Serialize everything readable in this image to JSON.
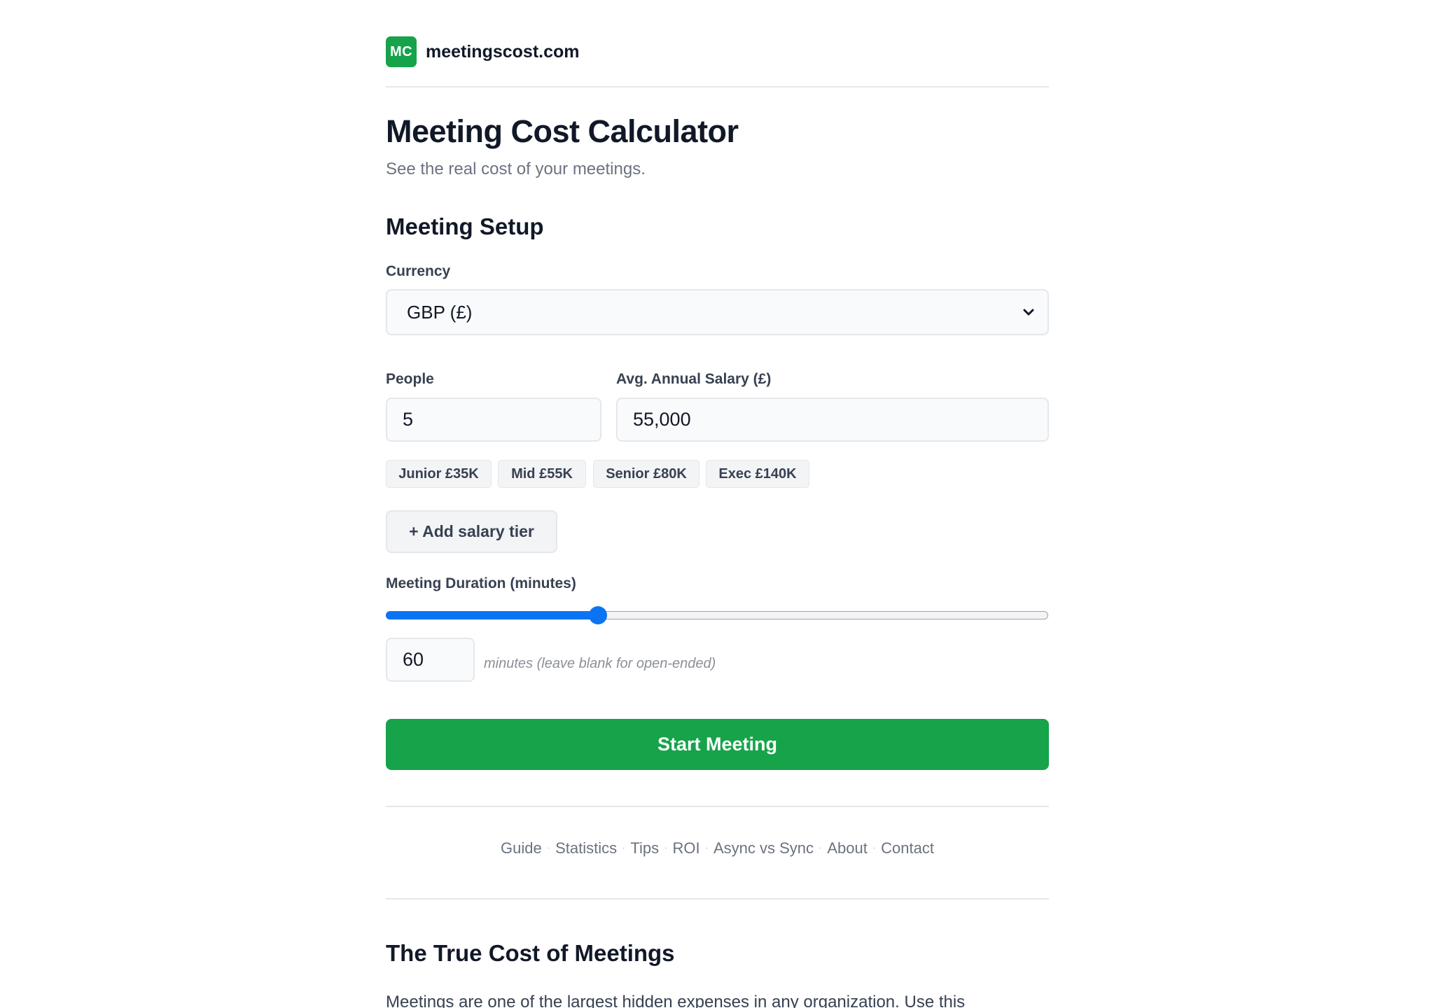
{
  "brand": {
    "logo_text": "MC",
    "name": "meetingscost.com",
    "logo_color": "#16a34a"
  },
  "page": {
    "title": "Meeting Cost Calculator",
    "subtitle": "See the real cost of your meetings."
  },
  "setup": {
    "heading": "Meeting Setup",
    "currency": {
      "label": "Currency",
      "selected": "GBP (£)"
    },
    "people": {
      "label": "People",
      "value": "5"
    },
    "salary": {
      "label": "Avg. Annual Salary (£)",
      "value": "55,000"
    },
    "tiers": [
      "Junior £35K",
      "Mid £55K",
      "Senior £80K",
      "Exec £140K"
    ],
    "add_tier_label": "+ Add salary tier",
    "duration": {
      "label": "Meeting Duration (minutes)",
      "slider_fraction": 0.32,
      "value": "60",
      "hint": "minutes (leave blank for open-ended)"
    },
    "start_label": "Start Meeting"
  },
  "footer_nav": [
    "Guide",
    "Statistics",
    "Tips",
    "ROI",
    "Async vs Sync",
    "About",
    "Contact"
  ],
  "article": {
    "heading": "The True Cost of Meetings",
    "intro": "Meetings are one of the largest hidden expenses in any organization. Use this"
  },
  "colors": {
    "accent": "#16a34a",
    "slider": "#0b74f4"
  }
}
